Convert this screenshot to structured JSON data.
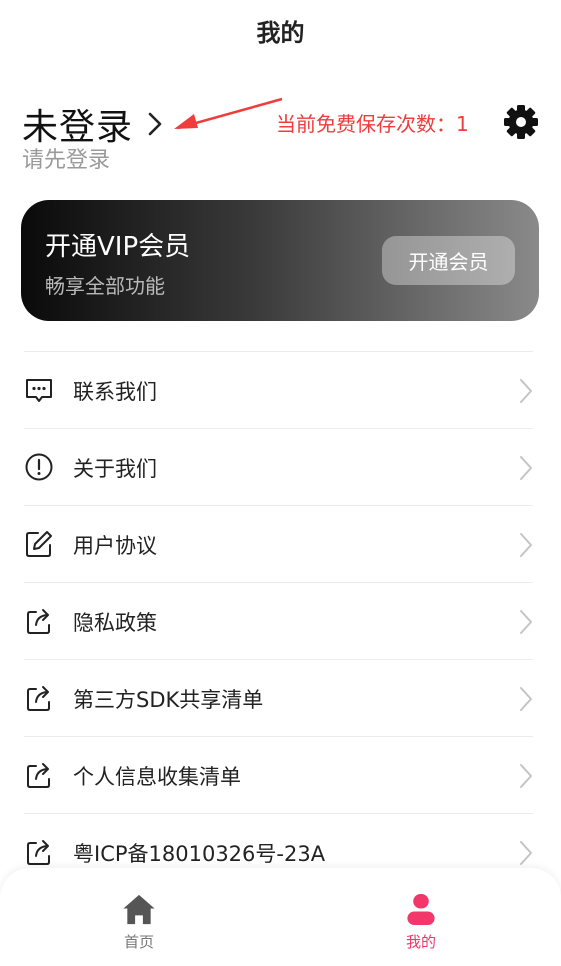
{
  "header": {
    "title": "我的"
  },
  "profile": {
    "login_title": "未登录",
    "login_subtitle": "请先登录",
    "free_save_count_label": "当前免费保存次数：1",
    "icons": {
      "chevron": "chevron-right-icon",
      "settings": "gear-icon"
    }
  },
  "vip": {
    "title": "开通VIP会员",
    "subtitle": "畅享全部功能",
    "button_label": "开通会员"
  },
  "menu": {
    "items": [
      {
        "label": "联系我们",
        "icon": "message-icon"
      },
      {
        "label": "关于我们",
        "icon": "info-circle-icon"
      },
      {
        "label": "用户协议",
        "icon": "edit-icon"
      },
      {
        "label": "隐私政策",
        "icon": "share-icon"
      },
      {
        "label": "第三方SDK共享清单",
        "icon": "share-icon"
      },
      {
        "label": "个人信息收集清单",
        "icon": "share-icon"
      },
      {
        "label": "粤ICP备18010326号-23A",
        "icon": "share-icon"
      }
    ]
  },
  "tabbar": {
    "tabs": [
      {
        "label": "首页",
        "icon": "home-icon",
        "active": false
      },
      {
        "label": "我的",
        "icon": "user-icon",
        "active": true
      }
    ]
  },
  "colors": {
    "annotation_red": "#f03c3c",
    "active_tab": "#f2386b",
    "inactive_tab": "#777777"
  }
}
